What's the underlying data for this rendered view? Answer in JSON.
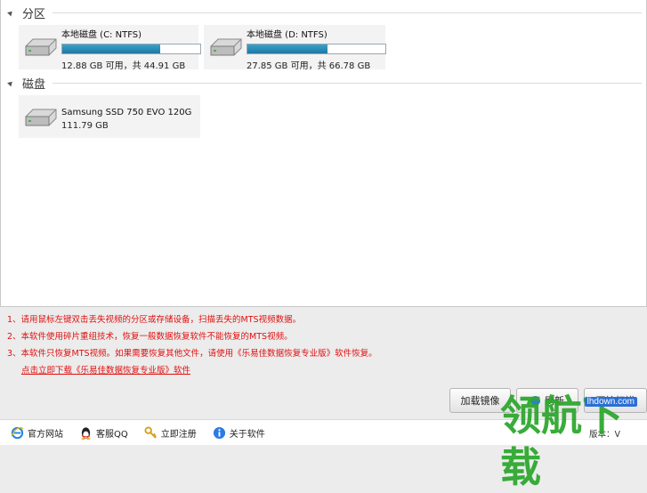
{
  "partition_section": {
    "title": "分区"
  },
  "partitions": [
    {
      "name": "本地磁盘 (C: NTFS)",
      "size": "12.88 GB 可用，共 44.91 GB",
      "used_fraction": 0.71,
      "bar_color": "#1d78a6"
    },
    {
      "name": "本地磁盘 (D: NTFS)",
      "size": "27.85 GB 可用，共 66.78 GB",
      "used_fraction": 0.58,
      "bar_color": "#1d78a6"
    }
  ],
  "disk_section": {
    "title": "磁盘"
  },
  "disks": [
    {
      "name": "Samsung SSD 750 EVO 120G",
      "size": "111.79 GB"
    }
  ],
  "notes": [
    "1、请用鼠标左键双击丢失视频的分区或存储设备，扫描丢失的MTS视频数据。",
    "2、本软件使用碎片重组技术，恢复一般数据恢复软件不能恢复的MTS视频。",
    "3、本软件只恢复MTS视频。如果需要恢复其他文件，请使用《乐易佳数据恢复专业版》软件恢复。"
  ],
  "download_link": "点击立即下载《乐易佳数据恢复专业版》软件",
  "buttons": {
    "mount": "加载镜像",
    "refresh": "刷新",
    "start": "开始扫描"
  },
  "footer": {
    "website": "官方网站",
    "qq": "客服QQ",
    "register": "立即注册",
    "about": "关于软件",
    "version": "版本：V"
  },
  "watermark": {
    "text": "领航下载",
    "site": "lhdown.com"
  },
  "icons": {
    "website": "ie-icon",
    "qq": "qq-penguin-icon",
    "register": "key-icon",
    "about": "info-icon",
    "drive": "hard-drive-icon"
  }
}
